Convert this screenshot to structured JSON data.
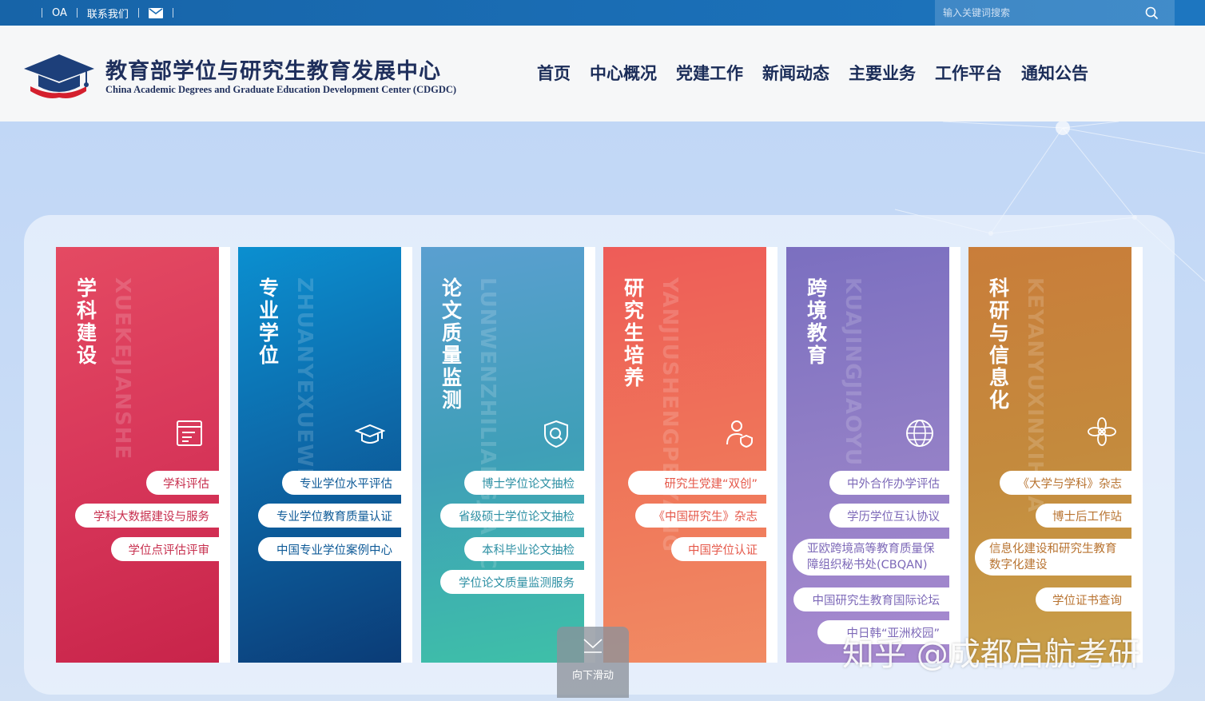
{
  "topbar": {
    "links": [
      "OA",
      "联系我们"
    ],
    "search_placeholder": "输入关键词搜索"
  },
  "header": {
    "title": "教育部学位与研究生教育发展中心",
    "subtitle": "China Academic Degrees and Graduate Education Development Center (CDGDC)"
  },
  "nav": [
    "首页",
    "中心概况",
    "党建工作",
    "新闻动态",
    "主要业务",
    "工作平台",
    "通知公告"
  ],
  "cards": [
    {
      "title": "学科建设",
      "pinyin": "XUEKEJIANSHE",
      "icon": "document-icon",
      "items": [
        "学科评估",
        "学科大数据建设与服务",
        "学位点评估评审"
      ]
    },
    {
      "title": "专业学位",
      "pinyin": "ZHUANYEXUEWEI",
      "icon": "graduation-cap-icon",
      "items": [
        "专业学位水平评估",
        "专业学位教育质量认证",
        "中国专业学位案例中心"
      ]
    },
    {
      "title": "论文质量监测",
      "pinyin": "LUNWENZHILIANGJIANCE",
      "icon": "shield-search-icon",
      "items": [
        "博士学位论文抽检",
        "省级硕士学位论文抽检",
        "本科毕业论文抽检",
        "学位论文质量监测服务"
      ]
    },
    {
      "title": "研究生培养",
      "pinyin": "YANJIUSHENGPEIYANG",
      "icon": "user-shield-icon",
      "items": [
        "研究生党建“双创”",
        "《中国研究生》杂志",
        "中国学位认证"
      ]
    },
    {
      "title": "跨境教育",
      "pinyin": "KUAJINGJIAOYU",
      "icon": "globe-icon",
      "items": [
        "中外合作办学评估",
        "学历学位互认协议",
        "亚欧跨境高等教育质量保障组织秘书处(CBQAN)",
        "中国研究生教育国际论坛",
        "中日韩“亚洲校园”"
      ]
    },
    {
      "title": "科研与信息化",
      "pinyin": "KEYANYUXINXIHUA",
      "icon": "flower-icon",
      "items": [
        "《大学与学科》杂志",
        "博士后工作站",
        "信息化建设和研究生教育数字化建设",
        "学位证书查询"
      ]
    }
  ],
  "scroll_label": "向下滑动",
  "watermark": "知乎 @成都启航考研",
  "colors": {
    "topbar": "#1a6bb3",
    "card1": "#d8375a",
    "card2": "#0e5e9e",
    "card3": "#3a9fb5",
    "card4": "#ee6a56",
    "card5": "#9b80c8",
    "card6": "#c98438"
  }
}
